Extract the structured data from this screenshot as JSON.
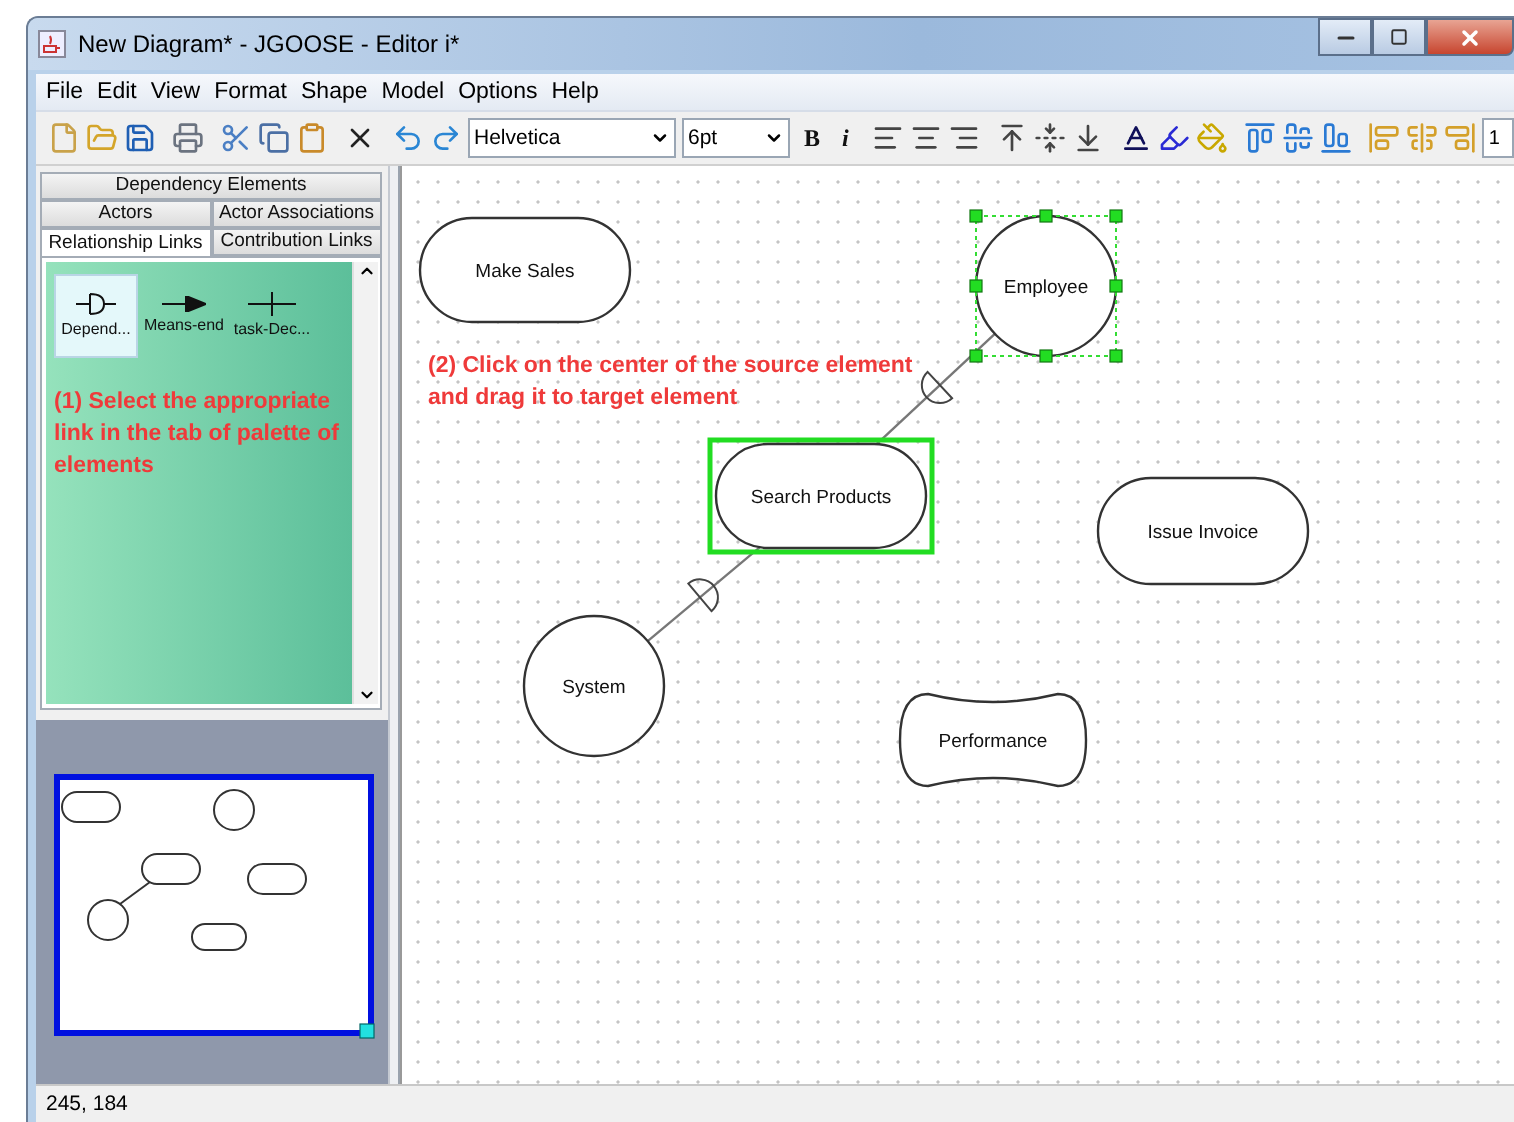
{
  "window": {
    "title": "New Diagram* - JGOOSE - Editor i*"
  },
  "menu": [
    "File",
    "Edit",
    "View",
    "Format",
    "Shape",
    "Model",
    "Options",
    "Help"
  ],
  "toolbar": [
    {
      "kind": "new"
    },
    {
      "kind": "open"
    },
    {
      "kind": "save"
    },
    {
      "kind": "separator"
    },
    {
      "kind": "print"
    },
    {
      "kind": "separator"
    },
    {
      "kind": "cut"
    },
    {
      "kind": "copy"
    },
    {
      "kind": "paste"
    },
    {
      "kind": "separator"
    },
    {
      "kind": "delete"
    },
    {
      "kind": "separator"
    },
    {
      "kind": "undo"
    },
    {
      "kind": "redo"
    },
    {
      "kind": "font",
      "value": "Helvetica"
    },
    {
      "kind": "size",
      "value": "6pt"
    },
    {
      "kind": "bold",
      "label": "B"
    },
    {
      "kind": "italic",
      "label": "i"
    },
    {
      "kind": "separator"
    },
    {
      "kind": "align-left"
    },
    {
      "kind": "align-center"
    },
    {
      "kind": "align-right"
    },
    {
      "kind": "separator"
    },
    {
      "kind": "valign-top"
    },
    {
      "kind": "valign-middle"
    },
    {
      "kind": "valign-bottom"
    },
    {
      "kind": "separator"
    },
    {
      "kind": "font-color"
    },
    {
      "kind": "line-color"
    },
    {
      "kind": "fill-color"
    },
    {
      "kind": "separator"
    },
    {
      "kind": "align-top"
    },
    {
      "kind": "align-middle"
    },
    {
      "kind": "align-bottom"
    },
    {
      "kind": "separator"
    },
    {
      "kind": "align-first"
    },
    {
      "kind": "align-centers"
    },
    {
      "kind": "align-last"
    },
    {
      "kind": "number",
      "value": "1"
    }
  ],
  "palette": {
    "tab_rows": [
      [
        {
          "label": "Dependency Elements",
          "selected": false
        }
      ],
      [
        {
          "label": "Actors",
          "selected": false
        },
        {
          "label": "Actor Associations",
          "selected": false
        }
      ],
      [
        {
          "label": "Relationship Links",
          "selected": true
        },
        {
          "label": "Contribution Links",
          "selected": false
        }
      ]
    ],
    "items": [
      {
        "label": "Depend...",
        "kind": "dependency",
        "selected": true
      },
      {
        "label": "Means-end",
        "kind": "means-end",
        "selected": false
      },
      {
        "label": "task-Dec...",
        "kind": "decomposition",
        "selected": false
      }
    ],
    "hint": "(1) Select the appropriate link in the tab of palette of elements"
  },
  "diagram": {
    "hint": "(2) Click on the center of the source element and drag it to target element",
    "nodes": [
      {
        "label": "Make Sales",
        "kind": "task",
        "selected": false,
        "highlighted": false
      },
      {
        "label": "Employee",
        "kind": "actor",
        "selected": true,
        "highlighted": false
      },
      {
        "label": "Search Products",
        "kind": "task",
        "selected": false,
        "highlighted": true
      },
      {
        "label": "Issue Invoice",
        "kind": "task",
        "selected": false,
        "highlighted": false
      },
      {
        "label": "System",
        "kind": "actor",
        "selected": false,
        "highlighted": false
      },
      {
        "label": "Performance",
        "kind": "softgoal",
        "selected": false,
        "highlighted": false
      }
    ],
    "links": [
      {
        "kind": "dependency"
      },
      {
        "kind": "dependency"
      }
    ]
  },
  "status_bar": "245, 184"
}
